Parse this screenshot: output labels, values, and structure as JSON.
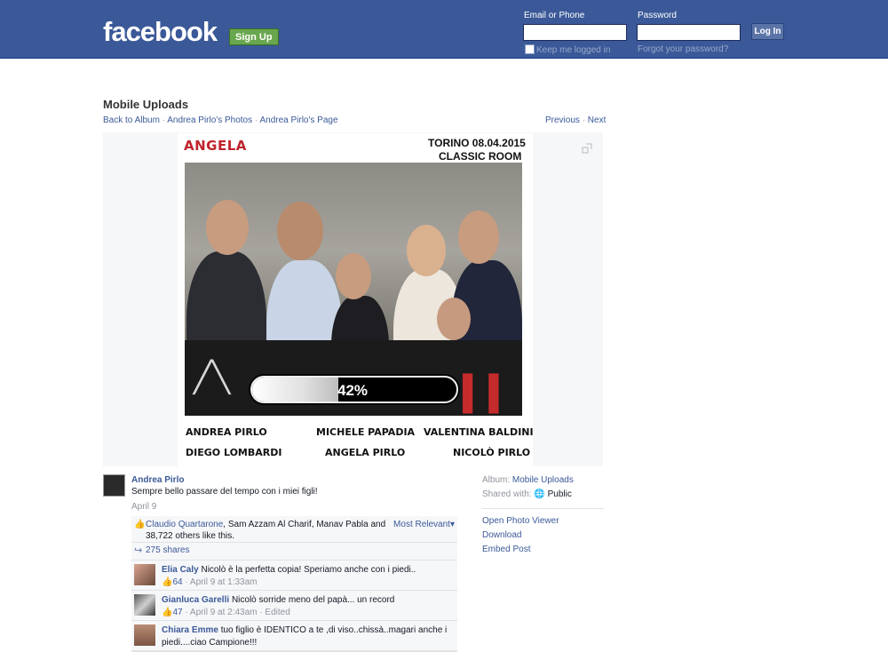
{
  "header": {
    "logo": "facebook",
    "signup": "Sign Up",
    "email_label": "Email or Phone",
    "password_label": "Password",
    "login_button": "Log In",
    "keep_logged": "Keep me logged in",
    "forgot": "Forgot your password?"
  },
  "album": {
    "title": "Mobile Uploads",
    "breadcrumb": [
      "Back to Album",
      "Andrea Pirlo's Photos",
      "Andrea Pirlo's Page"
    ],
    "previous": "Previous",
    "next": "Next"
  },
  "poster": {
    "name": "ANGELA",
    "date": "TORINO 08.04.2015",
    "room": "CLASSIC ROOM",
    "progress_percent": 42,
    "progress_label": "42%",
    "captions": [
      "ANDREA PIRLO",
      "MICHELE PAPADIA",
      "VALENTINA BALDINI",
      "DIEGO LOMBARDI",
      "ANGELA PIRLO",
      "NICOLÒ PIRLO"
    ]
  },
  "post": {
    "author": "Andrea Pirlo",
    "text": "Sempre bello passare del tempo con i miei figli!",
    "date": "April 9",
    "likes_first": "Claudio Quartarone",
    "likes_rest": ", Sam Azzam Al Charif, Manav Pabla and",
    "likes_line2": "38,722 others like this.",
    "most_relevant": "Most Relevant",
    "shares": "275 shares"
  },
  "comments": [
    {
      "name": "Elia Caly",
      "text": "Nicolò è la perfetta copia! Speriamo anche con i piedi..",
      "likes": "64",
      "meta": "· April 9 at 1:33am"
    },
    {
      "name": "Gianluca Garelli",
      "text": "Nicolò sorride meno del papà... un record",
      "likes": "47",
      "meta": "· April 9 at 2:43am · Edited"
    },
    {
      "name": "Chiara Emme",
      "text": "tuo figlio è IDENTICO a te ,di viso..chissà..magari anche i",
      "text2": "piedi....ciao Campione!!!",
      "likes": "",
      "meta": ""
    }
  ],
  "side": {
    "album_label": "Album:",
    "album_value": "Mobile Uploads",
    "shared_label": "Shared with:",
    "shared_value": "Public",
    "links": [
      "Open Photo Viewer",
      "Download",
      "Embed Post"
    ]
  },
  "colors": {
    "brand": "#3b5998",
    "signup": "#69a74e",
    "poster_red": "#c0232c"
  }
}
